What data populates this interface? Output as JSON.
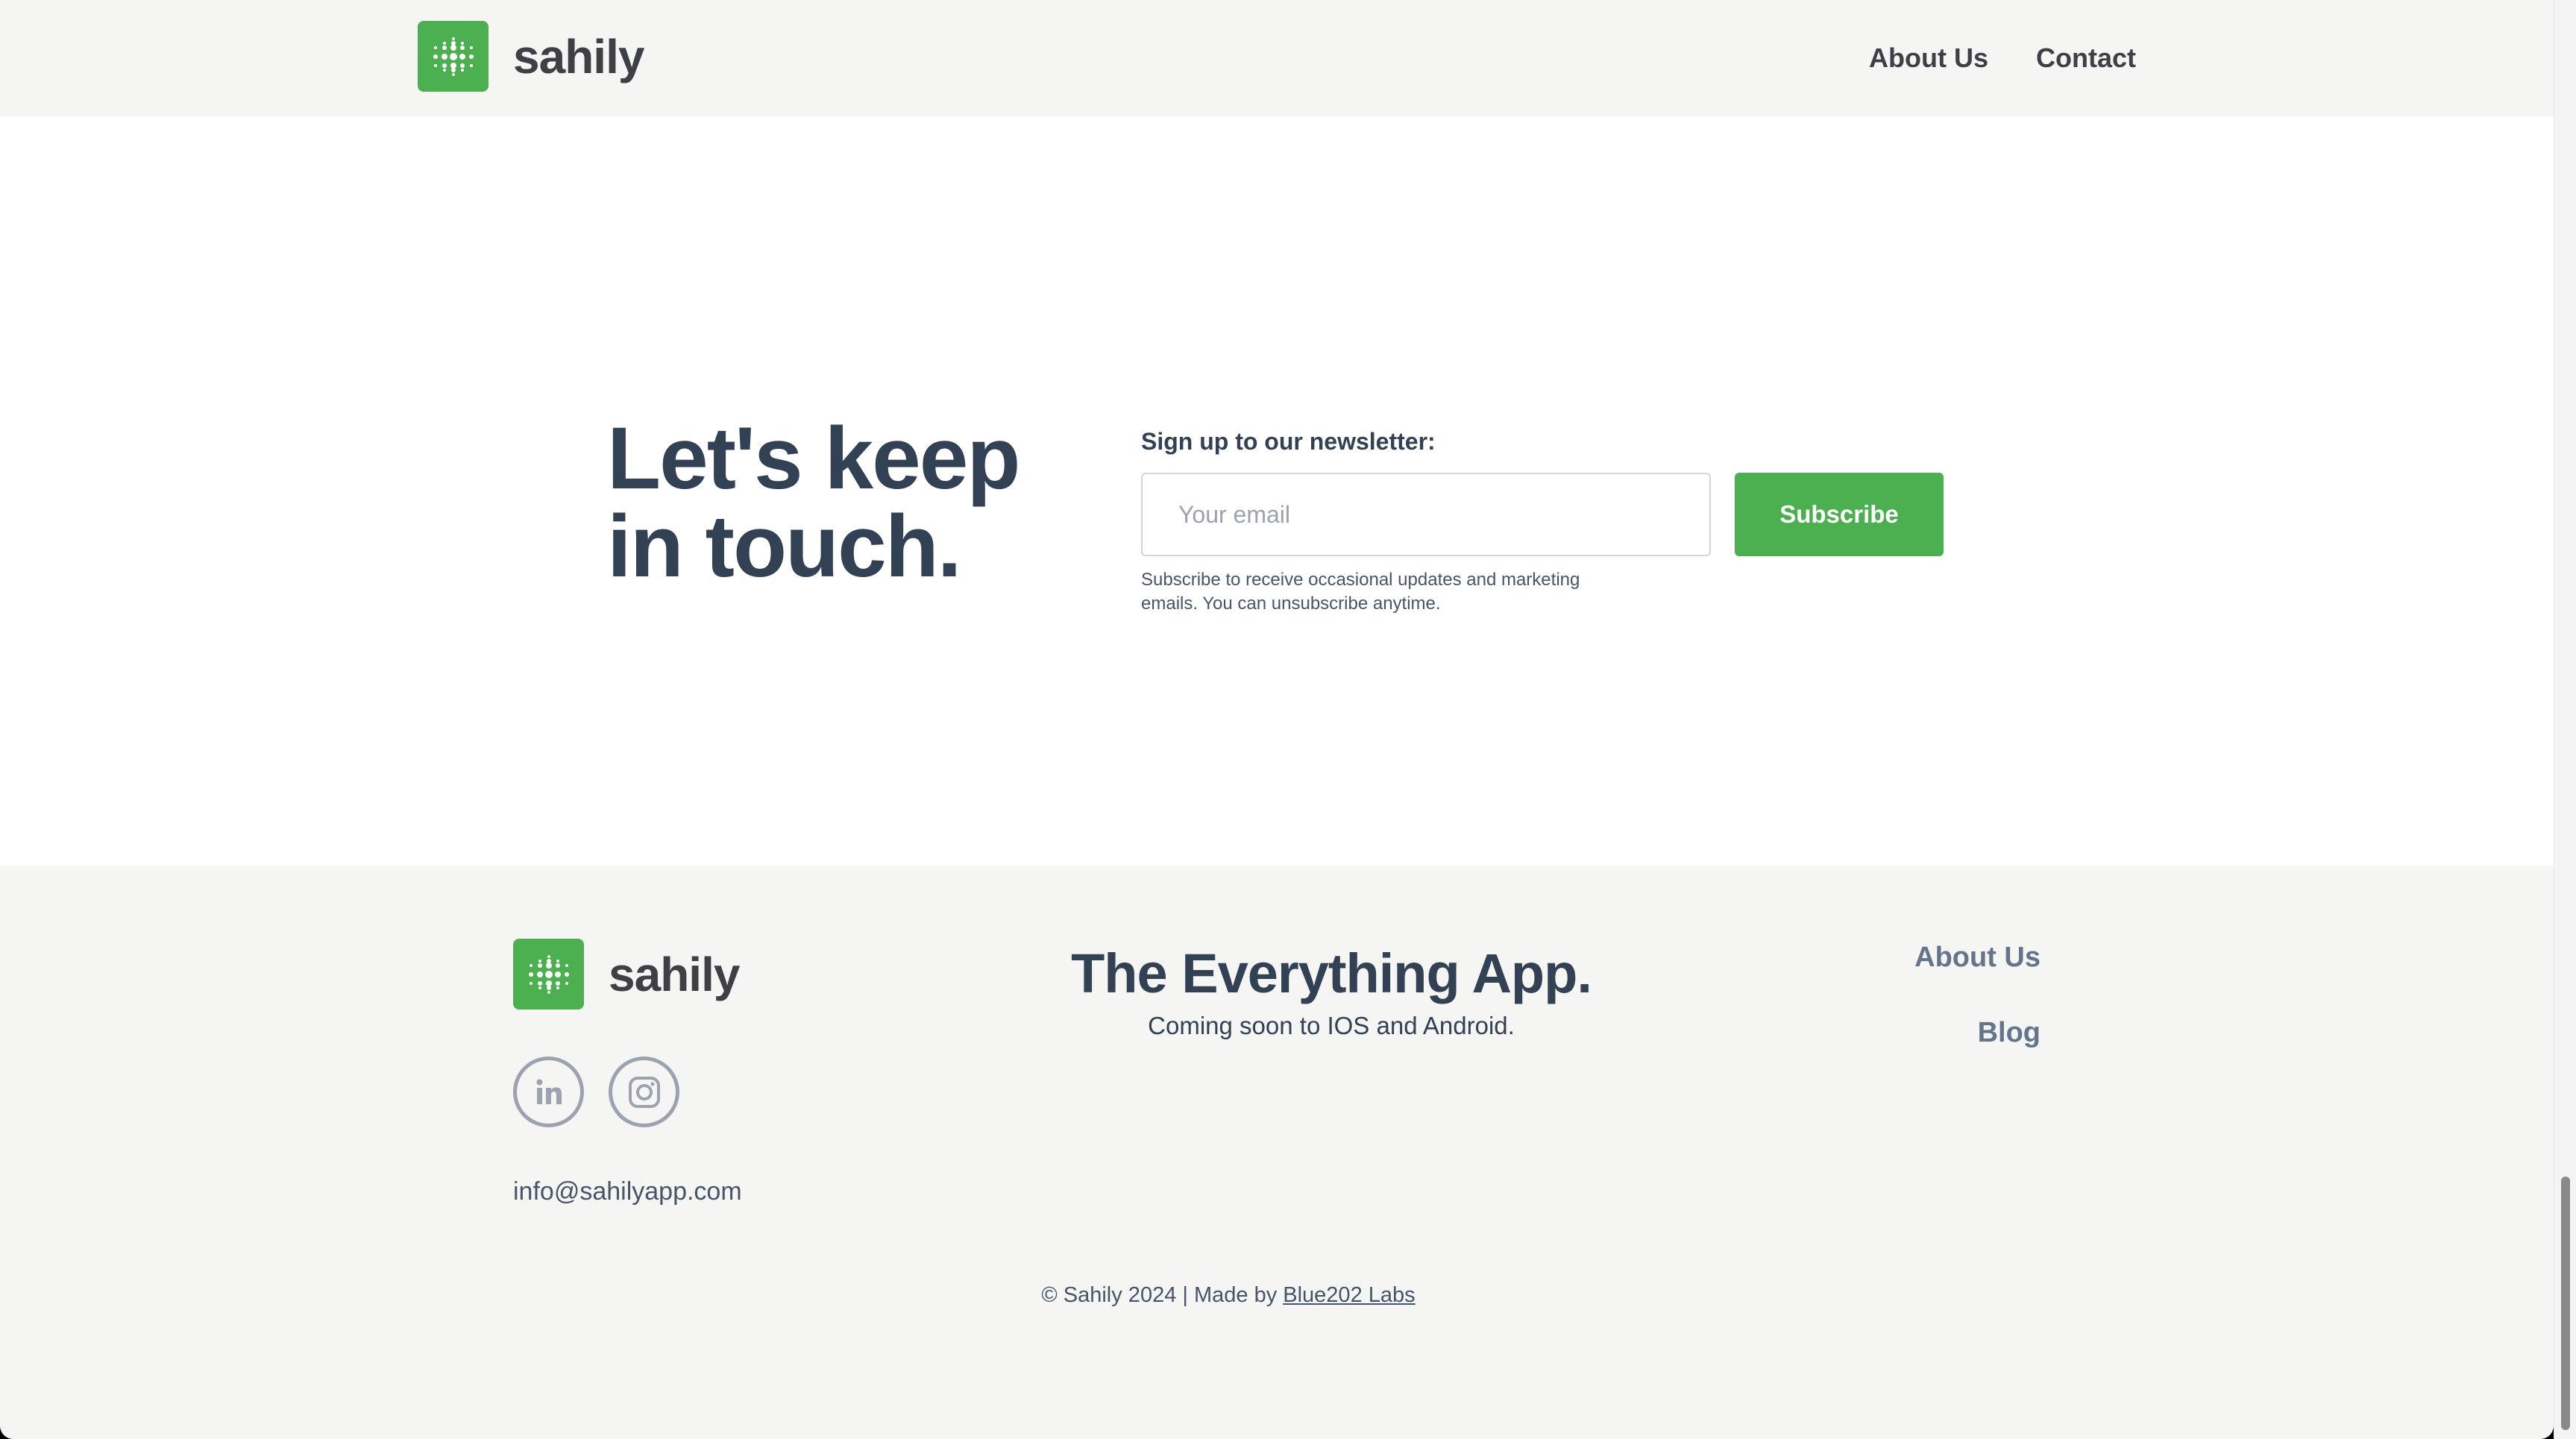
{
  "header": {
    "brand_name": "sahily",
    "logo_icon": "dot-grid-logo-icon",
    "nav": [
      {
        "label": "About Us"
      },
      {
        "label": "Contact"
      }
    ]
  },
  "newsletter": {
    "headline": "Let's keep in touch.",
    "label": "Sign up to our newsletter:",
    "email_placeholder": "Your email",
    "email_value": "",
    "subscribe_label": "Subscribe",
    "note": "Subscribe to receive occasional updates and marketing emails. You can unsubscribe anytime."
  },
  "footer": {
    "brand_name": "sahily",
    "socials": [
      {
        "name": "linkedin-icon"
      },
      {
        "name": "instagram-icon"
      }
    ],
    "email": "info@sahilyapp.com",
    "tagline": "The Everything App.",
    "subtagline": "Coming soon to IOS and Android.",
    "links": [
      {
        "label": "About Us"
      },
      {
        "label": "Blog"
      }
    ],
    "copyright_prefix": "© Sahily 2024 | Made by ",
    "copyright_link": "Blue202 Labs"
  },
  "colors": {
    "brand_green": "#4caf50",
    "heading": "#334155",
    "footer_bg": "#f5f5f4"
  }
}
